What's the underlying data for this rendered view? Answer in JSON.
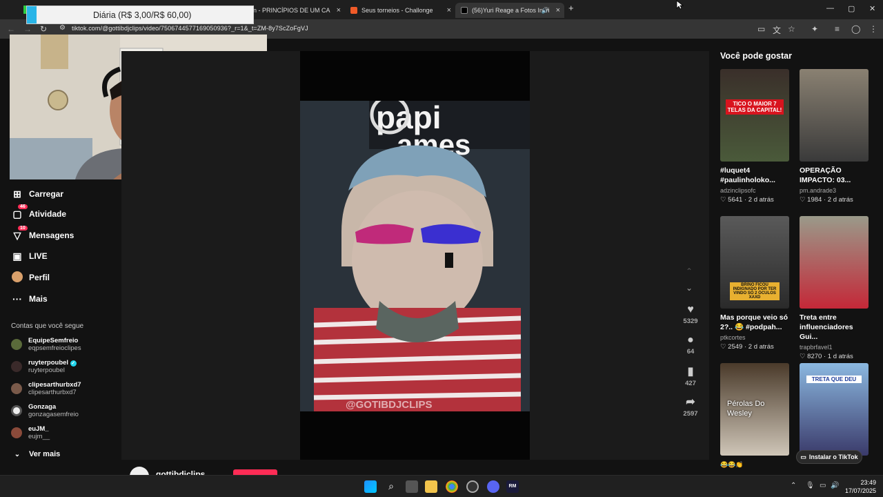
{
  "browser": {
    "tabs": [
      {
        "label": "chefin - PRINCÍPIOS DE UM CA",
        "close": "×"
      },
      {
        "label": "Seus torneios - Challonge",
        "close": "×"
      },
      {
        "label": "(56)Yuri Reage a Fotos Incri",
        "close": "×"
      }
    ],
    "new_tab": "+",
    "url": "tiktok.com/@gottibdjclips/video/7506744577169050936?_r=1&_t=ZM-8y7ScZoFgVJ",
    "window_controls": [
      "—",
      "▢",
      "✕"
    ]
  },
  "overlay": {
    "text": "Diária (R$ 3,00/R$ 60,00)"
  },
  "sidebar": {
    "nav": [
      {
        "label": "Carregar",
        "icon": "upload-icon"
      },
      {
        "label": "Atividade",
        "icon": "inbox-icon",
        "badge": "46"
      },
      {
        "label": "Mensagens",
        "icon": "messages-icon",
        "badge": "10"
      },
      {
        "label": "LIVE",
        "icon": "live-icon"
      },
      {
        "label": "Perfil",
        "icon": "avatar-icon"
      },
      {
        "label": "Mais",
        "icon": "more-icon"
      }
    ],
    "following_heading": "Contas que você segue",
    "following": [
      {
        "name": "EquipeSemfreio",
        "handle": "eqpsemfreioclipes"
      },
      {
        "name": "ruyterpoubel",
        "handle": "ruyterpoubel"
      },
      {
        "name": "clipesarthurbxd7",
        "handle": "clipesarthurbxd7"
      },
      {
        "name": "Gonzaga",
        "handle": "gonzagasemfreio"
      },
      {
        "name": "euJM_",
        "handle": "eujm__"
      }
    ],
    "see_more": "Ver mais"
  },
  "video": {
    "watermark": "@GOTIBDJCLIPS",
    "likes": "5329",
    "comments": "64",
    "saves": "427",
    "shares": "2597",
    "author_partial": "gottibdjclips"
  },
  "recommendations": {
    "title": "Você pode gostar",
    "cards": [
      {
        "title": "#luquet4 #paulinholoko...",
        "author": "adzinclipsofc",
        "likes": "5641",
        "age": "2 d atrás",
        "overlay": "TICO O MAIOR 7 TELAS DA CAPITAL!"
      },
      {
        "title": "OPERAÇÃO IMPACTO: 03...",
        "author": "pm.andrade3",
        "likes": "1984",
        "age": "2 d atrás",
        "overlay": ""
      },
      {
        "title": "Mas porque veio só 2?.. 😂 #podpah...",
        "author": "ptkcortes",
        "likes": "2549",
        "age": "2 d atrás",
        "overlay": "BRINO FICOU INDIGNADO POR TER VINDO SÓ 2 ÓCULOS XAXD"
      },
      {
        "title": "Treta entre influenciadores Gui...",
        "author": "trapbrfavel1",
        "likes": "8270",
        "age": "1 d atrás",
        "overlay": ""
      },
      {
        "title": "",
        "author": "",
        "likes": "",
        "age": "",
        "overlay": "Pérolas Do Wesley"
      },
      {
        "title": "",
        "author": "",
        "likes": "",
        "age": "",
        "overlay": "TRETA QUE DEU"
      }
    ],
    "install_button": "Instalar o TikTok"
  },
  "taskbar": {
    "time": "23:49",
    "date": "17/07/2025"
  },
  "colors": {
    "accent": "#fe2c55",
    "background": "#121212",
    "panel": "#1b1b1b"
  }
}
